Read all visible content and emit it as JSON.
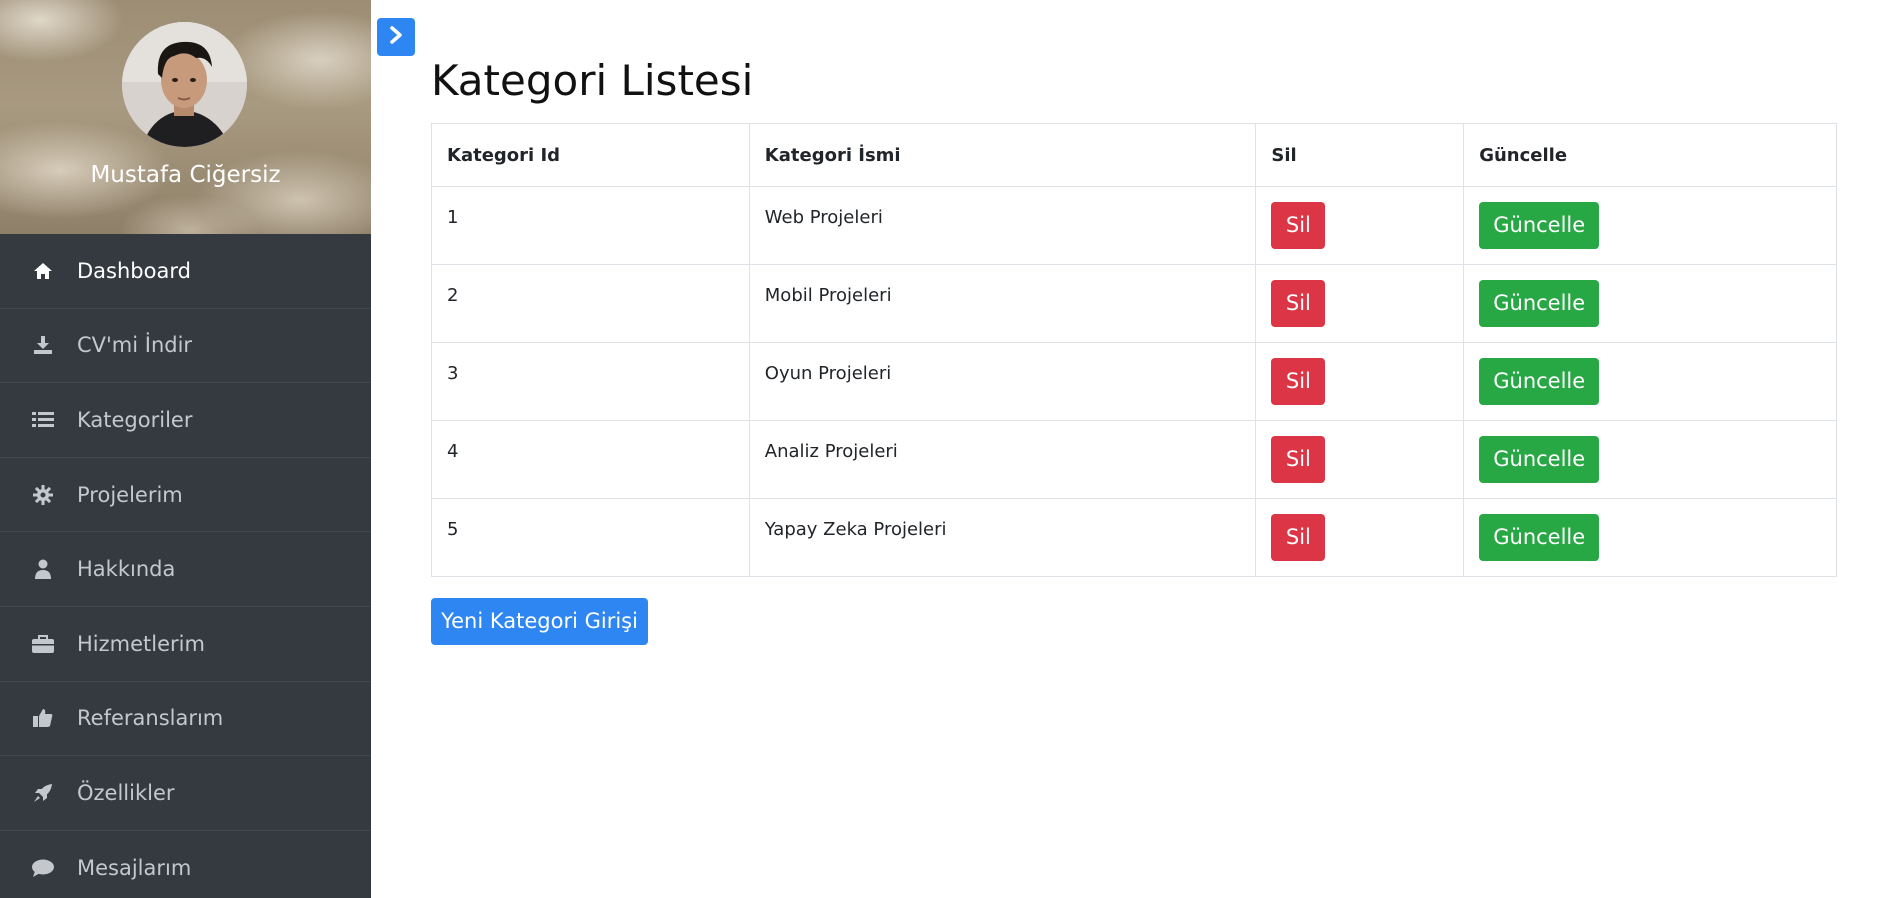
{
  "profile": {
    "name": "Mustafa Ciğersiz"
  },
  "sidebar": {
    "items": [
      {
        "label": "Dashboard",
        "icon": "home-icon",
        "active": true
      },
      {
        "label": "CV'mi İndir",
        "icon": "download-icon"
      },
      {
        "label": "Kategoriler",
        "icon": "list-icon"
      },
      {
        "label": "Projelerim",
        "icon": "gear-icon"
      },
      {
        "label": "Hakkında",
        "icon": "user-icon"
      },
      {
        "label": "Hizmetlerim",
        "icon": "briefcase-icon"
      },
      {
        "label": "Referanslarım",
        "icon": "thumbs-up-icon"
      },
      {
        "label": "Özellikler",
        "icon": "rocket-icon"
      },
      {
        "label": "Mesajlarım",
        "icon": "comment-icon"
      }
    ]
  },
  "toggle": {
    "icon": "chevron-right-icon"
  },
  "main": {
    "title": "Kategori Listesi",
    "table": {
      "headers": [
        "Kategori Id",
        "Kategori İsmi",
        "Sil",
        "Güncelle"
      ],
      "rows": [
        {
          "id": "1",
          "name": "Web Projeleri"
        },
        {
          "id": "2",
          "name": "Mobil Projeleri"
        },
        {
          "id": "3",
          "name": "Oyun Projeleri"
        },
        {
          "id": "4",
          "name": "Analiz Projeleri"
        },
        {
          "id": "5",
          "name": "Yapay Zeka Projeleri"
        }
      ],
      "delete_label": "Sil",
      "update_label": "Güncelle"
    },
    "new_button_label": "Yeni Kategori Girişi"
  },
  "colors": {
    "sidebar_bg": "#343a40",
    "primary": "#2d86f2",
    "danger": "#dc3545",
    "success": "#28a745"
  }
}
